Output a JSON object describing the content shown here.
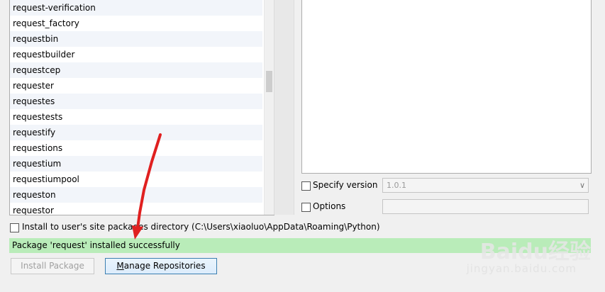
{
  "packages": [
    "request-verification",
    "request_factory",
    "requestbin",
    "requestbuilder",
    "requestcep",
    "requester",
    "requestes",
    "requestests",
    "requestify",
    "requestions",
    "requestium",
    "requestiumpool",
    "requeston",
    "requestor"
  ],
  "options": {
    "specify_version_label": "Specify version",
    "specify_version_checked": false,
    "version_value": "1.0.1",
    "options_label": "Options",
    "options_checked": false,
    "options_value": ""
  },
  "install_user_site": {
    "label": "Install to user's site packages directory (C:\\Users\\xiaoluo\\AppData\\Roaming\\Python)",
    "checked": false
  },
  "status": {
    "message": "Package 'request' installed successfully",
    "color": "#b9ecb9"
  },
  "buttons": {
    "install_label": "Install Package",
    "manage_mnemonic": "M",
    "manage_rest": "anage Repositories"
  },
  "annotation": {
    "color": "#e02020"
  },
  "watermark": {
    "logo": "Baidu经验",
    "sub": "jingyan.baidu.com"
  }
}
